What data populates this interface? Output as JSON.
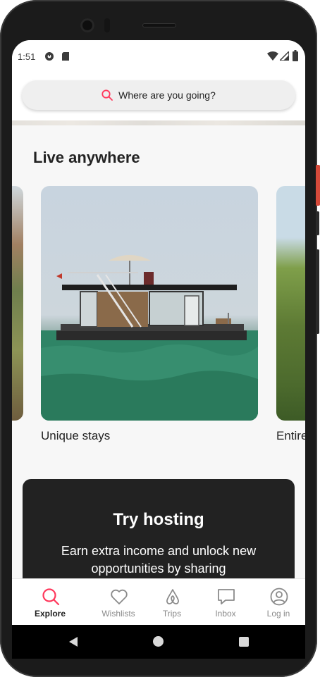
{
  "status_bar": {
    "time": "1:51",
    "icons": [
      "app-icon",
      "sd-card-icon",
      "wifi-icon",
      "signal-icon",
      "battery-icon"
    ]
  },
  "search": {
    "placeholder": "Where are you going?"
  },
  "section": {
    "title": "Live anywhere",
    "cards": [
      {
        "label": "Unique stays",
        "image": "houseboat-on-water"
      },
      {
        "label": "Entire",
        "image": "house-with-trees"
      }
    ]
  },
  "hosting": {
    "title": "Try hosting",
    "description": "Earn extra income and unlock new opportunities by sharing"
  },
  "tabs": [
    {
      "label": "Explore",
      "icon": "search-icon",
      "active": true
    },
    {
      "label": "Wishlists",
      "icon": "heart-icon",
      "active": false
    },
    {
      "label": "Trips",
      "icon": "airbnb-logo-icon",
      "active": false
    },
    {
      "label": "Inbox",
      "icon": "chat-bubble-icon",
      "active": false
    },
    {
      "label": "Log in",
      "icon": "user-circle-icon",
      "active": false
    }
  ],
  "colors": {
    "accent": "#ff385c",
    "text": "#222222",
    "muted": "#8a8a8a",
    "dark_card": "#222222"
  }
}
